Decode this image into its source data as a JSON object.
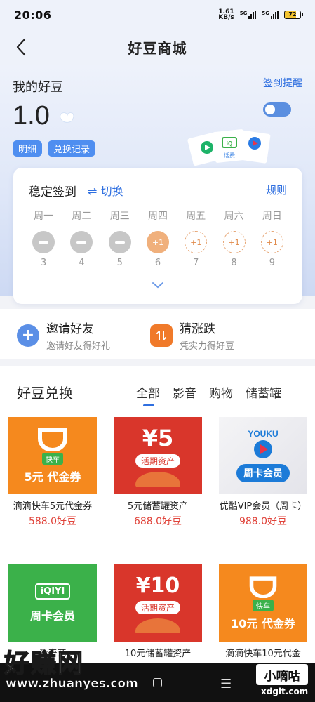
{
  "status_bar": {
    "time": "20:06",
    "net_speed": "1.61",
    "net_unit": "KB/s",
    "signal1": "5G",
    "signal2": "5G",
    "battery": "72"
  },
  "nav": {
    "title": "好豆商城"
  },
  "header": {
    "my_title": "我的好豆",
    "balance": "1.0",
    "tag_detail": "明细",
    "tag_records": "兑换记录",
    "remind_label": "签到提醒",
    "phone_bill": "话费"
  },
  "checkin": {
    "title": "稳定签到",
    "switch_label": "⇌ 切换",
    "rules_label": "规则",
    "days": [
      {
        "label": "周一",
        "num": "3",
        "state": "done",
        "mark": ""
      },
      {
        "label": "周二",
        "num": "4",
        "state": "done",
        "mark": ""
      },
      {
        "label": "周三",
        "num": "5",
        "state": "done",
        "mark": ""
      },
      {
        "label": "周四",
        "num": "6",
        "state": "today",
        "mark": "+1"
      },
      {
        "label": "周五",
        "num": "7",
        "state": "future",
        "mark": "+1"
      },
      {
        "label": "周六",
        "num": "8",
        "state": "future",
        "mark": "+1"
      },
      {
        "label": "周日",
        "num": "9",
        "state": "future",
        "mark": "+1"
      }
    ]
  },
  "actions": {
    "invite_title": "邀请好友",
    "invite_sub": "邀请好友得好礼",
    "guess_title": "猜涨跌",
    "guess_sub": "凭实力得好豆"
  },
  "exchange": {
    "title": "好豆兑换",
    "tabs": [
      "全部",
      "影音",
      "购物",
      "储蓄罐"
    ],
    "items": [
      {
        "name": "滴滴快车5元代金券",
        "price": "588.0好豆",
        "badge": "快车",
        "label": "5元 代金券"
      },
      {
        "name": "5元储蓄罐资产",
        "price": "688.0好豆",
        "amount": "¥5",
        "tag": "活期资产"
      },
      {
        "name": "优酷VIP会员（周卡）",
        "price": "988.0好豆",
        "brand": "YOUKU",
        "pill": "周卡会员"
      },
      {
        "name": "爱奇艺",
        "brand": "iQIYI",
        "label": "周卡会员"
      },
      {
        "name": "10元储蓄罐资产",
        "amount": "¥10",
        "tag": "活期资产"
      },
      {
        "name": "滴滴快车10元代金",
        "badge": "快车",
        "label": "10元 代金券"
      }
    ]
  },
  "watermark": {
    "big": "好赚网",
    "url": "www.zhuanyes.com",
    "badge": "小嘀咕",
    "domain": "xdglt.com"
  },
  "colors": {
    "accent": "#2f6fe0",
    "price": "#e0433a",
    "orange": "#f5891e",
    "red": "#d9362b"
  }
}
